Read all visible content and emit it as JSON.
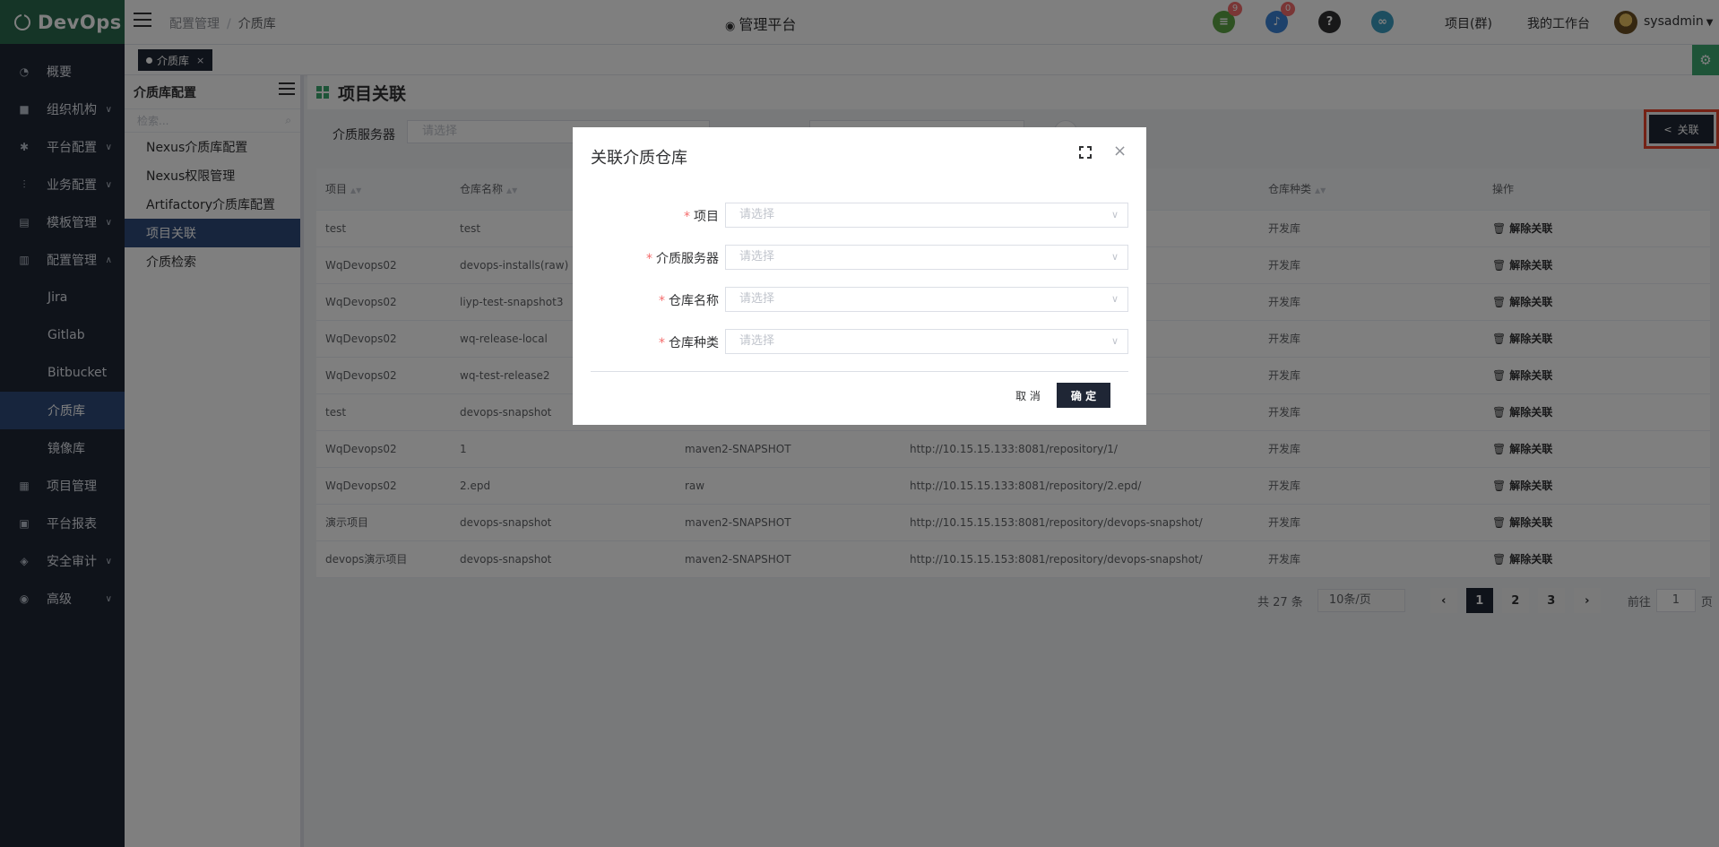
{
  "brand": {
    "name": "DevOps"
  },
  "sidebar": {
    "items": [
      {
        "label": "概要",
        "icon": "dashboard-icon",
        "chevron": ""
      },
      {
        "label": "组织机构",
        "icon": "lock-icon",
        "chevron": "∨"
      },
      {
        "label": "平台配置",
        "icon": "gear-icon",
        "chevron": "∨"
      },
      {
        "label": "业务配置",
        "icon": "sliders-icon",
        "chevron": "∨"
      },
      {
        "label": "模板管理",
        "icon": "template-icon",
        "chevron": "∨"
      },
      {
        "label": "配置管理",
        "icon": "database-icon",
        "chevron": "∧"
      }
    ],
    "sub_items": [
      {
        "label": "Jira"
      },
      {
        "label": "Gitlab"
      },
      {
        "label": "Bitbucket"
      },
      {
        "label": "介质库"
      },
      {
        "label": "镜像库"
      }
    ],
    "items_after": [
      {
        "label": "项目管理",
        "icon": "grid-icon",
        "chevron": ""
      },
      {
        "label": "平台报表",
        "icon": "monitor-icon",
        "chevron": ""
      },
      {
        "label": "安全审计",
        "icon": "shield-icon",
        "chevron": "∨"
      },
      {
        "label": "高级",
        "icon": "palette-icon",
        "chevron": "∨"
      }
    ]
  },
  "header": {
    "breadcrumb": [
      "配置管理",
      "介质库"
    ],
    "breadcrumb_sep": "/",
    "center_title": "管理平台",
    "badges": {
      "tasks": "9",
      "notifications": "0"
    },
    "help_glyph": "?",
    "project_link": "项目(群)",
    "workspace_link": "我的工作台",
    "username": "sysadmin"
  },
  "tabs": {
    "active_tab": "介质库"
  },
  "secondary": {
    "title": "介质库配置",
    "search_placeholder": "检索...",
    "items": [
      {
        "label": "Nexus介质库配置"
      },
      {
        "label": "Nexus权限管理"
      },
      {
        "label": "Artifactory介质库配置"
      },
      {
        "label": "项目关联"
      },
      {
        "label": "介质检索"
      }
    ]
  },
  "main": {
    "title": "项目关联",
    "filter_label": "介质服务器",
    "filter_placeholder": "请选择",
    "link_button": "关联",
    "columns": [
      "项目",
      "仓库名称",
      "",
      "",
      "仓库种类",
      "操作"
    ],
    "rows": [
      {
        "project": "test",
        "repo": "test",
        "format": "",
        "url": "",
        "kind": "开发库",
        "op": "解除关联"
      },
      {
        "project": "WqDevops02",
        "repo": "devops-installs(raw)",
        "format": "",
        "url": "alls/",
        "kind": "开发库",
        "op": "解除关联"
      },
      {
        "project": "WqDevops02",
        "repo": "liyp-test-snapshot3",
        "format": "",
        "url": "apshot3/",
        "kind": "开发库",
        "op": "解除关联"
      },
      {
        "project": "WqDevops02",
        "repo": "wq-release-local",
        "format": "",
        "url": "ocal/",
        "kind": "开发库",
        "op": "解除关联"
      },
      {
        "project": "WqDevops02",
        "repo": "wq-test-release2",
        "format": "",
        "url": "ase2/",
        "kind": "开发库",
        "op": "解除关联"
      },
      {
        "project": "test",
        "repo": "devops-snapshot",
        "format": "",
        "url": "pshot/",
        "kind": "开发库",
        "op": "解除关联"
      },
      {
        "project": "WqDevops02",
        "repo": "1",
        "format": "maven2-SNAPSHOT",
        "url": "http://10.15.15.133:8081/repository/1/",
        "kind": "开发库",
        "op": "解除关联"
      },
      {
        "project": "WqDevops02",
        "repo": "2.epd",
        "format": "raw",
        "url": "http://10.15.15.133:8081/repository/2.epd/",
        "kind": "开发库",
        "op": "解除关联"
      },
      {
        "project": "演示项目",
        "repo": "devops-snapshot",
        "format": "maven2-SNAPSHOT",
        "url": "http://10.15.15.153:8081/repository/devops-snapshot/",
        "kind": "开发库",
        "op": "解除关联"
      },
      {
        "project": "devops演示项目",
        "repo": "devops-snapshot",
        "format": "maven2-SNAPSHOT",
        "url": "http://10.15.15.153:8081/repository/devops-snapshot/",
        "kind": "开发库",
        "op": "解除关联"
      }
    ],
    "pagination": {
      "total_text": "共 27 条",
      "page_size": "10条/页",
      "prev": "‹",
      "pages": [
        "1",
        "2",
        "3"
      ],
      "next": "›",
      "goto_label": "前往",
      "goto_value": "1",
      "goto_suffix": "页"
    }
  },
  "dialog": {
    "title": "关联介质仓库",
    "fields": [
      {
        "label": "项目",
        "placeholder": "请选择"
      },
      {
        "label": "介质服务器",
        "placeholder": "请选择"
      },
      {
        "label": "仓库名称",
        "placeholder": "请选择"
      },
      {
        "label": "仓库种类",
        "placeholder": "请选择"
      }
    ],
    "cancel": "取 消",
    "ok": "确 定"
  },
  "colors": {
    "sidebar_bg": "#1f2635",
    "logo_bg": "#2b6a4f",
    "active_bg": "#2e4a7a",
    "highlight_outline": "#e8452c",
    "required": "#f56c6c"
  }
}
